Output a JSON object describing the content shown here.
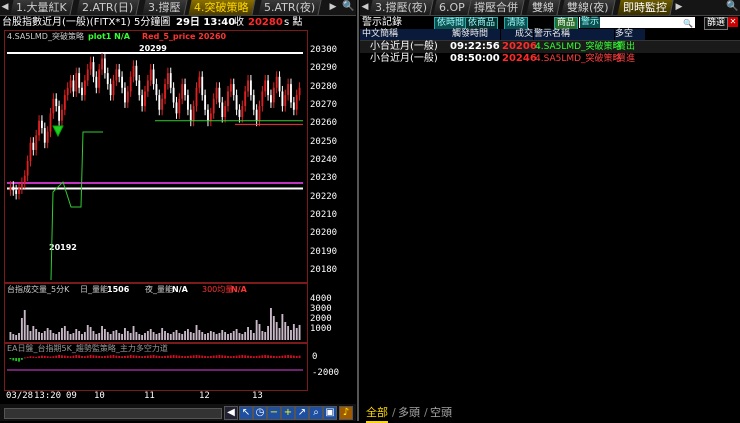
{
  "left_tabs": [
    "1.大量紅K",
    "2.ATR(日)",
    "3.撐壓",
    "4.突破策略",
    "5.ATR(夜)"
  ],
  "right_tabs": [
    "3.撐壓(夜)",
    "6.OP",
    "撐壓合併",
    "雙線",
    "雙線(夜)",
    "即時監控"
  ],
  "info": {
    "symbol": "台股指數近月(一般)(FITX*1)",
    "interval": "5分鐘圖",
    "date_time": "29日 13:40",
    "close_label": "收",
    "close_value": "20280",
    "suffix": "s 點"
  },
  "price_panel": {
    "title": "4.SA5LMD_突破策略",
    "plot1_label": "plot1 N/A",
    "red_label": "Red_5_price 20260",
    "high_label": "20299",
    "low_label": "20192",
    "y_ticks": [
      "20300",
      "20290",
      "20280",
      "20270",
      "20260",
      "20250",
      "20240",
      "20230",
      "20220",
      "20210",
      "20200",
      "20190",
      "20180"
    ]
  },
  "volume_panel": {
    "title": "台指成交量_5分K",
    "vol_label": "日_量能",
    "vol_value": "1506",
    "vol2_label": "夜_量能",
    "vol2_value": "N/A",
    "vol3_label": "300均量",
    "vol3_value": "N/A",
    "y_ticks": [
      "4000",
      "3000",
      "2000",
      "1000"
    ]
  },
  "indicator_panel": {
    "title": "EA日盤_台指期5K_趨勢監策略_主力多空力道",
    "y_ticks": [
      "0",
      "-2000"
    ]
  },
  "x_axis": [
    "03/28",
    "13:20",
    "09",
    "10",
    "11",
    "12",
    "13"
  ],
  "toolbar_icons": [
    "left-arrow-icon",
    "right-arrow-icon",
    "cursor-icon",
    "clock-icon",
    "minus-icon",
    "plus-icon",
    "zoom-icon",
    "fit-icon",
    "settings-icon",
    "bell-icon"
  ],
  "monitor": {
    "title": "警示記錄",
    "btn_by_time": "依時間",
    "btn_by_product": "依商品",
    "btn_clear": "清除",
    "product_label": "商品",
    "search_label": "警示",
    "filter_label": "篩選",
    "columns": [
      "中文簡稱",
      "觸發時間",
      "成交",
      "警示名稱",
      "多空"
    ],
    "rows": [
      {
        "name": "小台近月(一般)",
        "time": "09:22:56",
        "price": "20206",
        "alert": "4.SA5LMD_突破策略",
        "side": "賣出"
      },
      {
        "name": "小台近月(一般)",
        "time": "08:50:00",
        "price": "20246",
        "alert": "4.SA5LMD_突破策略",
        "side": "買進"
      }
    ]
  },
  "bottom_tabs": [
    "全部",
    "多頭",
    "空頭"
  ],
  "chart_data": {
    "type": "candlestick",
    "ylim": [
      20175,
      20305
    ],
    "levels": {
      "white_top": 20299,
      "white_mid": 20225,
      "pink": 20228,
      "green_line": 20262,
      "red_line": 20260
    },
    "closes": [
      20226,
      20224,
      20222,
      20225,
      20228,
      20232,
      20240,
      20250,
      20246,
      20254,
      20262,
      20258,
      20250,
      20256,
      20266,
      20274,
      20270,
      20262,
      20268,
      20276,
      20280,
      20284,
      20278,
      20288,
      20280,
      20276,
      20284,
      20290,
      20294,
      20286,
      20280,
      20290,
      20296,
      20288,
      20282,
      20276,
      20284,
      20290,
      20286,
      20280,
      20272,
      20278,
      20286,
      20292,
      20284,
      20276,
      20270,
      20278,
      20284,
      20290,
      20282,
      20276,
      20268,
      20274,
      20282,
      20288,
      20280,
      20272,
      20266,
      20274,
      20282,
      20276,
      20268,
      20262,
      20270,
      20280,
      20286,
      20276,
      20268,
      20262,
      20266,
      20274,
      20280,
      20272,
      20264,
      20270,
      20278,
      20282,
      20276,
      20268,
      20264,
      20270,
      20278,
      20284,
      20276,
      20268,
      20262,
      20270,
      20278,
      20284,
      20276,
      20272,
      20280,
      20286,
      20278,
      20270,
      20276,
      20282,
      20272,
      20268,
      20276,
      20280
    ],
    "volumes": [
      800,
      600,
      500,
      700,
      2200,
      3000,
      1500,
      900,
      1400,
      1100,
      800,
      700,
      900,
      1200,
      1000,
      700,
      600,
      800,
      1200,
      1400,
      900,
      600,
      700,
      1100,
      900,
      600,
      800,
      1500,
      1300,
      900,
      600,
      700,
      1400,
      1100,
      800,
      600,
      900,
      1000,
      700,
      600,
      1200,
      900,
      700,
      1400,
      800,
      600,
      500,
      700,
      900,
      1100,
      800,
      600,
      700,
      1200,
      900,
      700,
      600,
      800,
      1000,
      700,
      600,
      900,
      1100,
      800,
      700,
      1500,
      1000,
      800,
      600,
      700,
      900,
      800,
      600,
      700,
      1000,
      800,
      600,
      700,
      900,
      1100,
      700,
      600,
      800,
      1300,
      1000,
      700,
      2000,
      1600,
      900,
      800,
      1400,
      3200,
      2400,
      1800,
      1200,
      2600,
      1800,
      1400,
      1000,
      1600,
      1200,
      1506
    ],
    "indicator": [
      -200,
      -400,
      -500,
      -600,
      -300,
      100,
      200,
      300,
      250,
      200,
      300,
      400,
      350,
      300,
      250,
      300,
      400,
      500,
      450,
      400,
      350,
      300,
      400,
      500,
      450,
      350,
      300,
      400,
      500,
      450,
      400,
      350,
      300,
      350,
      400,
      450,
      500,
      400,
      350,
      300,
      350,
      400,
      500,
      450,
      400,
      350,
      300,
      350,
      400,
      450,
      500,
      400,
      350,
      300,
      350,
      400,
      450,
      500,
      450,
      400,
      350,
      300,
      350,
      400,
      450,
      500,
      450,
      400,
      350,
      300,
      350,
      400,
      450,
      500,
      450,
      400,
      350,
      300,
      350,
      400,
      450,
      500,
      450,
      400,
      350,
      300,
      350,
      400,
      450,
      500,
      450,
      400,
      350,
      300,
      350,
      400,
      450,
      500,
      450,
      400,
      350,
      400
    ]
  }
}
